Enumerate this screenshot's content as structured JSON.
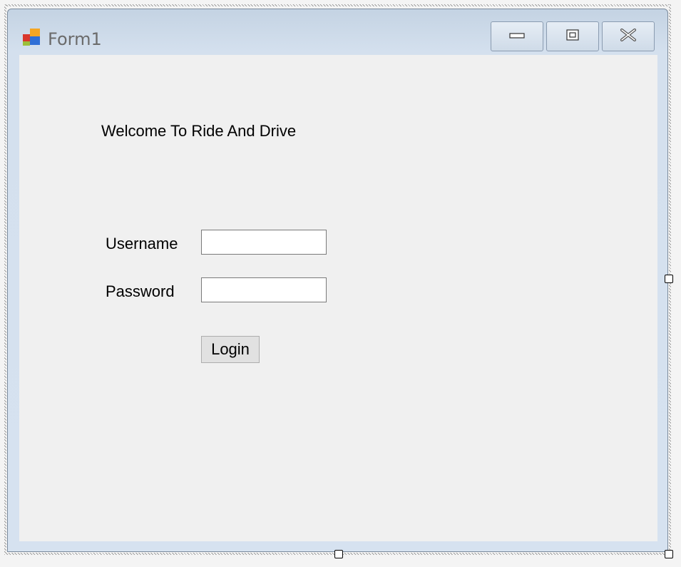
{
  "window": {
    "title": "Form1",
    "icon": "winforms-app-icon",
    "controls": {
      "minimize_icon": "minimize-icon",
      "maximize_icon": "maximize-icon",
      "close_icon": "close-icon"
    }
  },
  "form": {
    "welcome_text": "Welcome To Ride And Drive",
    "username_label": "Username",
    "username_value": "",
    "password_label": "Password",
    "password_value": "",
    "login_label": "Login"
  },
  "colors": {
    "titlebar": "#c4d3e3",
    "client_background": "#f0f0f0",
    "button_background": "#e1e1e1"
  }
}
